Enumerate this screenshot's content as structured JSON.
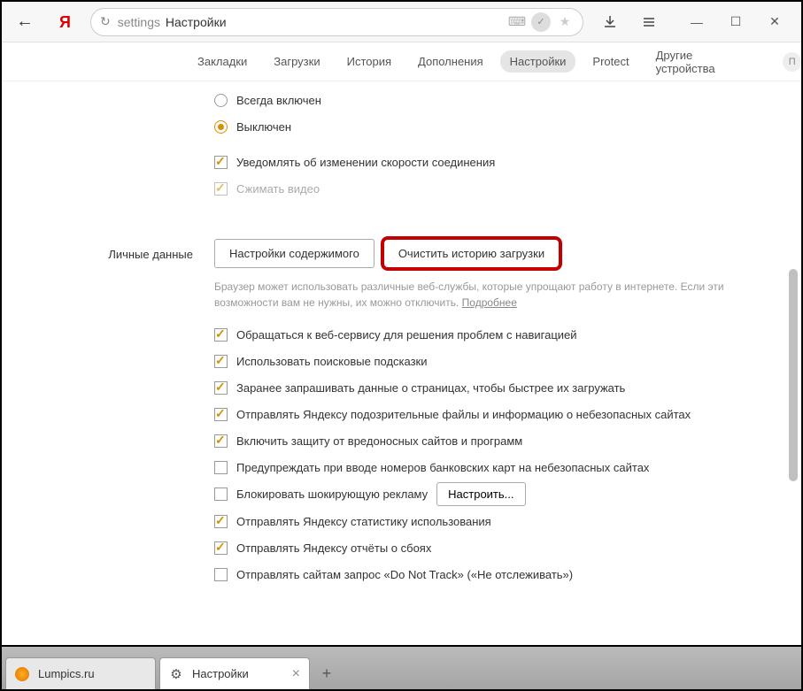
{
  "titlebar": {
    "addr_prefix": "settings",
    "addr_title": "Настройки"
  },
  "navtabs": [
    "Закладки",
    "Загрузки",
    "История",
    "Дополнения",
    "Настройки",
    "Protect",
    "Другие устройства"
  ],
  "navtab_active": 4,
  "profile_letter": "П",
  "radios": {
    "always_on": "Всегда включен",
    "off": "Выключен"
  },
  "top_checks": {
    "notify_speed": "Уведомлять об изменении скорости соединения",
    "compress_video": "Сжимать видео"
  },
  "section_personal": {
    "title": "Личные данные",
    "btn_content": "Настройки содержимого",
    "btn_clear": "Очистить историю загрузки",
    "hint": "Браузер может использовать различные веб-службы, которые упрощают работу в интернете. Если эти возможности вам не нужны, их можно отключить.",
    "hint_link": "Подробнее",
    "checks": [
      {
        "label": "Обращаться к веб-сервису для решения проблем с навигацией",
        "checked": true
      },
      {
        "label": "Использовать поисковые подсказки",
        "checked": true
      },
      {
        "label": "Заранее запрашивать данные о страницах, чтобы быстрее их загружать",
        "checked": true
      },
      {
        "label": "Отправлять Яндексу подозрительные файлы и информацию о небезопасных сайтах",
        "checked": true
      },
      {
        "label": "Включить защиту от вредоносных сайтов и программ",
        "checked": true
      },
      {
        "label": "Предупреждать при вводе номеров банковских карт на небезопасных сайтах",
        "checked": false
      },
      {
        "label": "Блокировать шокирующую рекламу",
        "checked": false,
        "button": "Настроить..."
      },
      {
        "label": "Отправлять Яндексу статистику использования",
        "checked": true
      },
      {
        "label": "Отправлять Яндексу отчёты о сбоях",
        "checked": true
      },
      {
        "label": "Отправлять сайтам запрос «Do Not Track» («Не отслеживать»)",
        "checked": false
      }
    ]
  },
  "tabs": [
    {
      "title": "Lumpics.ru",
      "icon": "orange"
    },
    {
      "title": "Настройки",
      "icon": "gear",
      "active": true,
      "closable": true
    }
  ]
}
